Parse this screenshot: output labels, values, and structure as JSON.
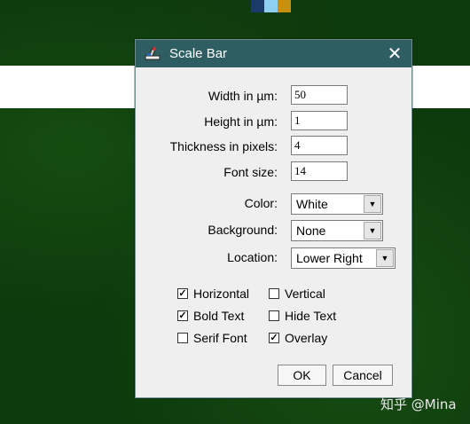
{
  "top_strip": {
    "colors": [
      "#1a3a6a",
      "#8fd0f0",
      "#c89010"
    ]
  },
  "dialog": {
    "title": "Scale Bar",
    "close_symbol": "✕",
    "icon": "imagej-microscope-icon"
  },
  "fields": [
    {
      "label": "Width in µm:",
      "value": "50"
    },
    {
      "label": "Height in µm:",
      "value": "1"
    },
    {
      "label": "Thickness in pixels:",
      "value": "4"
    },
    {
      "label": "Font size:",
      "value": "14"
    }
  ],
  "selects": [
    {
      "label": "Color:",
      "value": "White"
    },
    {
      "label": "Background:",
      "value": "None"
    },
    {
      "label": "Location:",
      "value": "Lower Right"
    }
  ],
  "checkboxes": [
    {
      "label": "Horizontal",
      "checked": true
    },
    {
      "label": "Vertical",
      "checked": false
    },
    {
      "label": "Bold Text",
      "checked": true
    },
    {
      "label": "Hide Text",
      "checked": false
    },
    {
      "label": "Serif Font",
      "checked": false
    },
    {
      "label": "Overlay",
      "checked": true
    }
  ],
  "buttons": {
    "ok": "OK",
    "cancel": "Cancel"
  },
  "watermark": "知乎 @Mina"
}
